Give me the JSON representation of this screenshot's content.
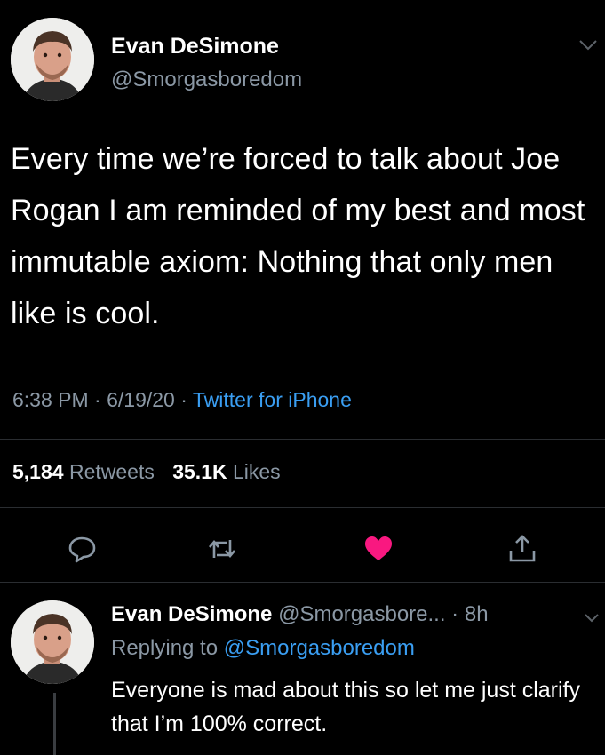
{
  "tweet": {
    "author": {
      "name": "Evan DeSimone",
      "handle": "@Smorgasboredom",
      "avatar_icon": "profile-photo-icon"
    },
    "text": "Every time we’re forced to talk about Joe Rogan I am reminded of my best and most immutable axiom: Nothing that only men like is cool.",
    "meta": {
      "time": "6:38 PM",
      "sep1": " · ",
      "date": "6/19/20",
      "sep2": " · ",
      "source": "Twitter for iPhone"
    },
    "stats": {
      "retweets_count": "5,184",
      "retweets_label": "Retweets",
      "likes_count": "35.1K",
      "likes_label": "Likes"
    },
    "actions": [
      {
        "name": "reply",
        "icon": "reply-icon"
      },
      {
        "name": "retweet",
        "icon": "retweet-icon"
      },
      {
        "name": "like",
        "icon": "heart-icon",
        "active": true
      },
      {
        "name": "share",
        "icon": "share-icon"
      }
    ]
  },
  "reply": {
    "name": "Evan DeSimone",
    "handle": "@Smorgasbore...",
    "age": " · 8h",
    "replying_prefix": "Replying to ",
    "replying_handle": "@Smorgasboredom",
    "text": "Everyone is mad about this so let me just clarify that I’m 100% correct."
  },
  "colors": {
    "background": "#000000",
    "link": "#3a9ef2",
    "secondary_text": "#8b98a5",
    "like_active": "#f91880"
  }
}
